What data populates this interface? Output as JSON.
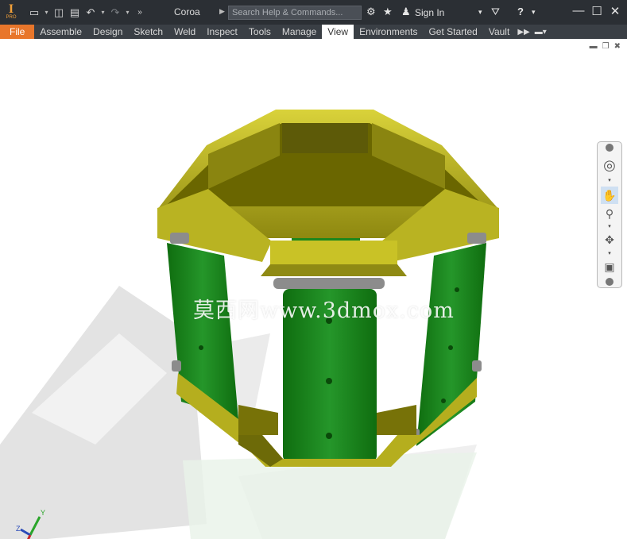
{
  "window": {
    "document_title": "Coroa",
    "search_placeholder": "Search Help & Commands...",
    "sign_in": "Sign In"
  },
  "ribbon": {
    "tabs": [
      {
        "label": "File"
      },
      {
        "label": "Assemble"
      },
      {
        "label": "Design"
      },
      {
        "label": "Sketch"
      },
      {
        "label": "Weld"
      },
      {
        "label": "Inspect"
      },
      {
        "label": "Tools"
      },
      {
        "label": "Manage"
      },
      {
        "label": "View"
      },
      {
        "label": "Environments"
      },
      {
        "label": "Get Started"
      },
      {
        "label": "Vault"
      }
    ],
    "active_tab": "View"
  },
  "viewport": {
    "watermark": "莫西网www.3dmox.com",
    "axis_labels": {
      "x": "X",
      "y": "Y",
      "z": "Z"
    }
  },
  "colors": {
    "titlebar": "#2b2f34",
    "ribbon": "#3a3f45",
    "file_tab": "#e8762b",
    "frame_yellow": "#c6be1a",
    "panel_green": "#1e8a1e"
  }
}
